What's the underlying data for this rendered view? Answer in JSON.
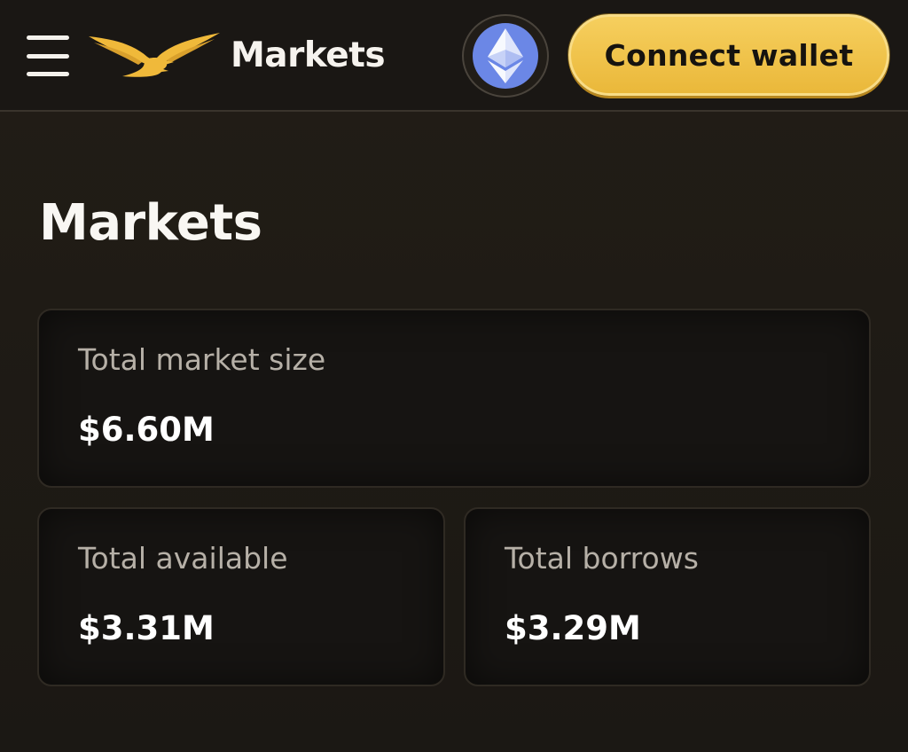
{
  "header": {
    "title": "Markets",
    "menu_icon": "hamburger-menu-icon",
    "logo_icon": "eagle-logo-icon",
    "network_icon": "ethereum-icon",
    "connect_label": "Connect wallet"
  },
  "main": {
    "title": "Markets",
    "stats": {
      "total_market_size": {
        "label": "Total market size",
        "value": "$6.60M"
      },
      "total_available": {
        "label": "Total available",
        "value": "$3.31M"
      },
      "total_borrows": {
        "label": "Total borrows",
        "value": "$3.29M"
      }
    }
  },
  "colors": {
    "background": "#1f1b15",
    "accent_gold": "#f1c44a",
    "ethereum_blue": "#6b87e6",
    "muted_text": "#b6b0a7",
    "card_background": "#161412"
  }
}
